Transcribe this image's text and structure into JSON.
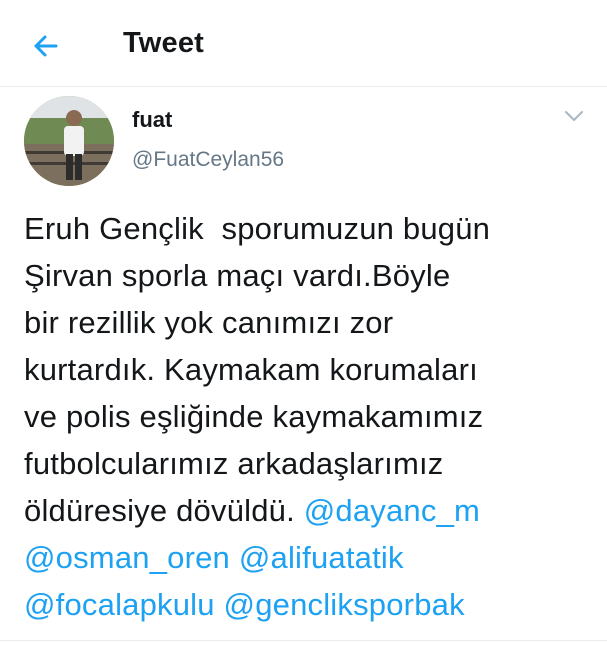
{
  "header": {
    "title": "Tweet",
    "back_icon": "arrow-left-icon",
    "accent": "#1da1f2"
  },
  "tweet": {
    "author_name": "fuat",
    "author_handle": "@FuatCeylan56",
    "menu_icon": "chevron-down-icon",
    "text_lines": [
      "Eruh Gençlik  sporumuzun bugün",
      "Şirvan sporla maçı vardı.Böyle",
      "bir rezillik yok canımızı zor",
      "kurtardık. Kaymakam korumaları",
      "ve polis eşliğinde kaymakamımız",
      "futbolcularımız arkadaşlarımız",
      "öldüresiye dövüldü. "
    ],
    "mentions": [
      "@dayanc_m",
      "@osman_oren",
      "@alifuatatik",
      "@focalapkulu",
      "@genclikspоrbak"
    ]
  }
}
